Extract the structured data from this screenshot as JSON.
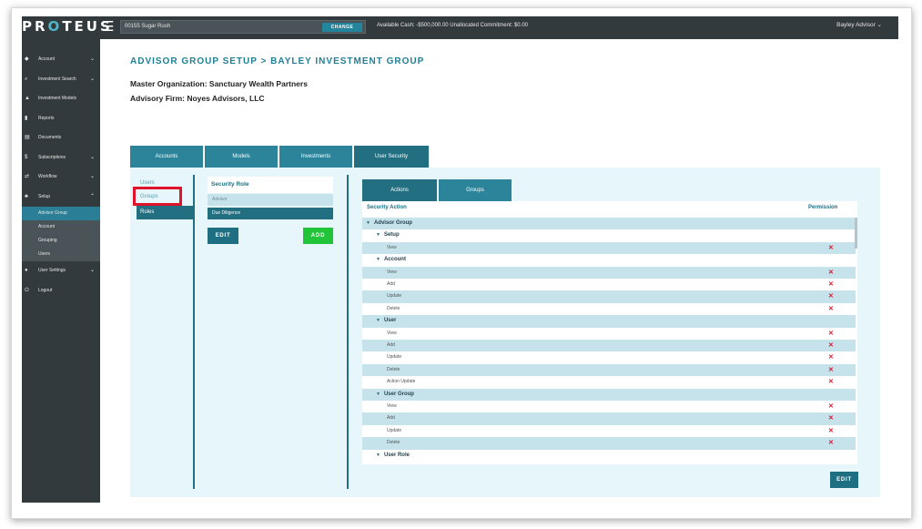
{
  "topbar": {
    "logo_pre": "PR",
    "logo_o": "O",
    "logo_post": "TEUS",
    "menu_icon": "☰",
    "account_value": "00155 Sugar Rush",
    "change_label": "CHANGE",
    "cash_info": "Available Cash: -$500,000.00    Unallocated Commitment: $0.00",
    "user_menu": "Bayley Advisor ⌄"
  },
  "sidebar": {
    "items": [
      {
        "label": "Account",
        "icon": "◆",
        "chev": "⌄"
      },
      {
        "label": "Investment Search",
        "icon": "⌕",
        "chev": "⌄"
      },
      {
        "label": "Investment Models",
        "icon": "▲",
        "chev": ""
      },
      {
        "label": "Reports",
        "icon": "▮",
        "chev": ""
      },
      {
        "label": "Documents",
        "icon": "▤",
        "chev": ""
      },
      {
        "label": "Subscriptions",
        "icon": "$",
        "chev": "⌄"
      },
      {
        "label": "Workflow",
        "icon": "⇄",
        "chev": "⌄"
      },
      {
        "label": "Setup",
        "icon": "♣",
        "chev": "⌃"
      }
    ],
    "setup_sub": [
      "Advisor Group",
      "Account",
      "Grouping",
      "Users"
    ],
    "bottom_items": [
      {
        "label": "User Settings",
        "icon": "●",
        "chev": "⌄"
      },
      {
        "label": "Logout",
        "icon": "⏻",
        "chev": ""
      }
    ]
  },
  "header": {
    "title": "ADVISOR GROUP SETUP > BAYLEY INVESTMENT GROUP",
    "master_org": "Master Organization: Sanctuary Wealth Partners",
    "advisory_firm": "Advisory Firm: Noyes Advisors, LLC"
  },
  "main_tabs": [
    "Accounts",
    "Models",
    "Investments",
    "User Security"
  ],
  "left_nav": {
    "users": "Users",
    "groups": "Groups",
    "roles": "Roles"
  },
  "security_role": {
    "header": "Security Role",
    "rows": [
      "Advisor",
      "Due Diligence"
    ],
    "edit_label": "EDIT",
    "add_label": "ADD"
  },
  "sub_tabs": [
    "Actions",
    "Groups"
  ],
  "permissions": {
    "col_action": "Security Action",
    "col_permission": "Permission",
    "deny_icon": "✕",
    "rows": [
      {
        "label": "Advisor Group",
        "level": 0,
        "group": true
      },
      {
        "label": "Setup",
        "level": 1,
        "group": true
      },
      {
        "label": "View",
        "level": 2,
        "group": false
      },
      {
        "label": "Account",
        "level": 1,
        "group": true
      },
      {
        "label": "View",
        "level": 2,
        "group": false
      },
      {
        "label": "Add",
        "level": 2,
        "group": false
      },
      {
        "label": "Update",
        "level": 2,
        "group": false
      },
      {
        "label": "Delete",
        "level": 2,
        "group": false
      },
      {
        "label": "User",
        "level": 1,
        "group": true
      },
      {
        "label": "View",
        "level": 2,
        "group": false
      },
      {
        "label": "Add",
        "level": 2,
        "group": false
      },
      {
        "label": "Update",
        "level": 2,
        "group": false
      },
      {
        "label": "Delete",
        "level": 2,
        "group": false
      },
      {
        "label": "Action Update",
        "level": 2,
        "group": false
      },
      {
        "label": "User Group",
        "level": 1,
        "group": true
      },
      {
        "label": "View",
        "level": 2,
        "group": false
      },
      {
        "label": "Add",
        "level": 2,
        "group": false
      },
      {
        "label": "Update",
        "level": 2,
        "group": false
      },
      {
        "label": "Delete",
        "level": 2,
        "group": false
      },
      {
        "label": "User Role",
        "level": 1,
        "group": true
      }
    ],
    "edit_label": "EDIT"
  },
  "colors": {
    "accent": "#2b849a",
    "dark_accent": "#226f82",
    "sidebar": "#333a3e",
    "deny": "#e0112b",
    "add": "#22c43a",
    "highlight": "#e0112b"
  }
}
